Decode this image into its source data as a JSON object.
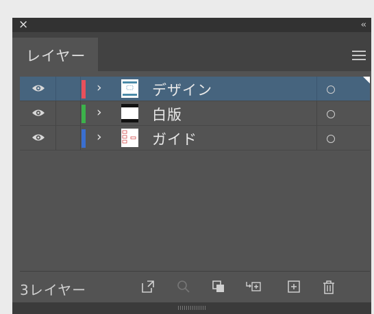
{
  "titlebar": {
    "close_glyph": "×",
    "collapse_glyph": "‹‹"
  },
  "tab": {
    "label": "レイヤー"
  },
  "layers": [
    {
      "name": "デザイン",
      "color": "#e8505b",
      "selected": true,
      "visible": true
    },
    {
      "name": "白版",
      "color": "#3cb24a",
      "selected": false,
      "visible": true
    },
    {
      "name": "ガイド",
      "color": "#3a6fd0",
      "selected": false,
      "visible": true
    }
  ],
  "footer": {
    "count_label": "3レイヤー",
    "icons": [
      "export-icon",
      "search-icon",
      "clipping-mask-icon",
      "sublayer-icon",
      "new-layer-icon",
      "trash-icon"
    ]
  },
  "colors": {
    "panel": "#535353",
    "selected_row": "#46647e",
    "titlebar": "#323232"
  }
}
